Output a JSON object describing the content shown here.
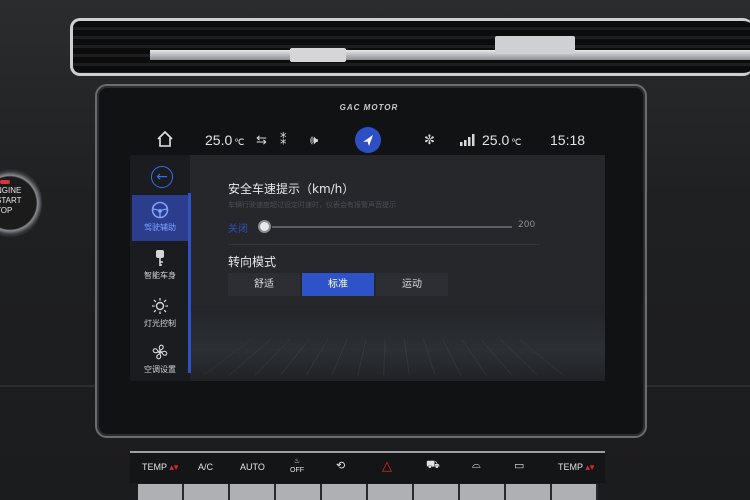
{
  "brand": "GAC MOTOR",
  "physical": {
    "start_button_text": [
      "NGINE",
      "START",
      "TOP"
    ]
  },
  "status_bar": {
    "left_temp_value": "25.0",
    "right_temp_value": "25.0",
    "temp_unit": "℃",
    "time": "15:18"
  },
  "sidebar": {
    "items": [
      {
        "label": "驾驶辅助",
        "icon": "steering-wheel-icon",
        "active": true
      },
      {
        "label": "智能车身",
        "icon": "key-icon",
        "active": false
      },
      {
        "label": "灯光控制",
        "icon": "light-icon",
        "active": false
      },
      {
        "label": "空调设置",
        "icon": "fan-icon",
        "active": false
      }
    ]
  },
  "speed_alert": {
    "title": "安全车速提示（km/h）",
    "hint": "车辆行驶速度超过设定时速时，仪表会有报警声音提示",
    "current_label": "关闭",
    "max_label": "200",
    "value": 0
  },
  "steering_mode": {
    "title": "转向模式",
    "options": [
      "舒适",
      "标准",
      "运动"
    ],
    "selected": "标准"
  },
  "climate": {
    "temp_left": "TEMP",
    "ac": "A/C",
    "auto": "AUTO",
    "off": "OFF",
    "temp_right": "TEMP"
  },
  "colors": {
    "accent": "#2e52c7",
    "hazard": "#e02a2a"
  }
}
